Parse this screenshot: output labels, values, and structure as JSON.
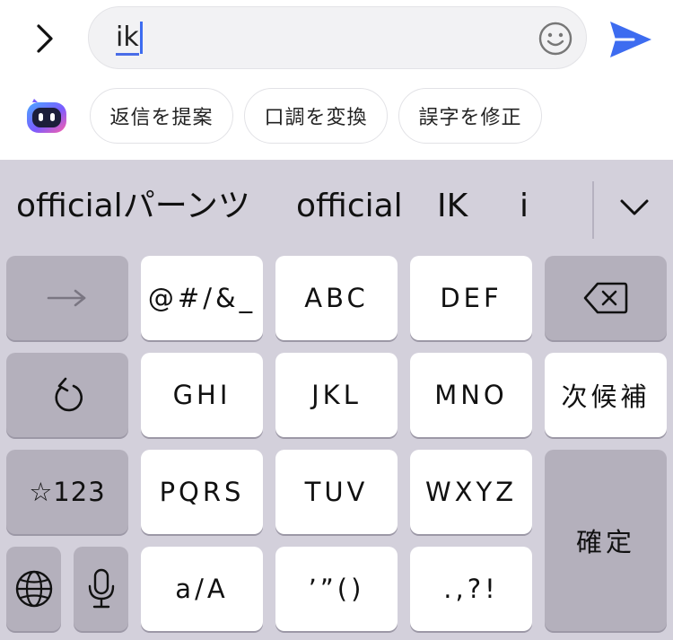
{
  "input": {
    "text": "ik"
  },
  "icons": {
    "expand": "chevron-right-icon",
    "emoji": "smiley-icon",
    "send": "send-arrow-icon",
    "ai": "ai-assistant-icon",
    "candidates_more": "chevron-down-icon",
    "next_cursor": "right-arrow-icon",
    "backspace": "backspace-icon",
    "undo": "undo-icon",
    "globe": "globe-icon",
    "mic": "microphone-icon"
  },
  "colors": {
    "accent": "#3d6cf0",
    "keyboard_bg": "#d3d0db",
    "function_key": "#b4b0bc",
    "letter_key": "#ffffff"
  },
  "ai_suggestions": {
    "chips": [
      "返信を提案",
      "口調を変換",
      "誤字を修正"
    ]
  },
  "candidates": [
    "officialパーンツ",
    "official",
    "IK",
    "i"
  ],
  "keys": {
    "row1": [
      "@#/&_",
      "ABC",
      "DEF"
    ],
    "row2": [
      "GHI",
      "JKL",
      "MNO"
    ],
    "row3": [
      "PQRS",
      "TUV",
      "WXYZ"
    ],
    "row4": [
      "a/A",
      "’”()",
      ".,?!"
    ],
    "next_candidate": "次候補",
    "symbols": "☆123",
    "confirm": "確定"
  }
}
